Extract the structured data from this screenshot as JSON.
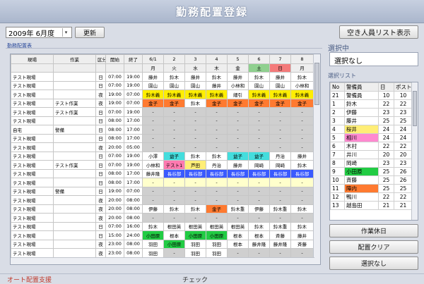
{
  "window": {
    "title": "勤務配置登録"
  },
  "date_picker": {
    "value": "2009年 6月度",
    "dropdown_glyph": "▾"
  },
  "update_button": "更新",
  "vacancy_button": "空き人員リスト表示",
  "assignments_label": "勤務配置表",
  "grid": {
    "headers": [
      "現場",
      "作業",
      "区分",
      "開始",
      "終了",
      "6/1",
      "2",
      "3",
      "4",
      "5",
      "6",
      "7",
      "8"
    ],
    "weekdays": [
      "月",
      "火",
      "水",
      "木",
      "金",
      "土",
      "日",
      "月"
    ],
    "rows": [
      {
        "site": "テスト現場",
        "work": "",
        "kubun": "日",
        "start": "07:00",
        "end": "19:00",
        "cells": [
          "藤井",
          "鈴木",
          "藤井",
          "鈴木",
          "藤井",
          "鈴木",
          "藤井",
          "鈴木"
        ],
        "colors": [
          "#ffffff",
          "#ffffff",
          "#ffffff",
          "#ffffff",
          "#ffffff",
          "#ffffff",
          "#ffffff",
          "#ffffff"
        ]
      },
      {
        "site": "テスト現場",
        "work": "",
        "kubun": "日",
        "start": "07:00",
        "end": "19:00",
        "cells": [
          "園山",
          "園山",
          "園山",
          "藤井",
          "小林和",
          "園山",
          "園山",
          "小林和"
        ],
        "colors": [
          "#ffffff",
          "#ffffff",
          "#ffffff",
          "#ffffff",
          "#ffffff",
          "#ffffff",
          "#ffffff",
          "#ffffff"
        ]
      },
      {
        "site": "テスト現場",
        "work": "",
        "kubun": "夜",
        "start": "19:00",
        "end": "07:00",
        "cells": [
          "鈴木義",
          "鈴木義",
          "鈴木義",
          "鈴木義",
          "細引",
          "鈴木義",
          "鈴木義",
          "鈴木義"
        ],
        "colors": [
          "#ffee00",
          "#ffee00",
          "#ffee00",
          "#ffee00",
          "#ffffff",
          "#ffee00",
          "#ffee00",
          "#ffee00"
        ]
      },
      {
        "site": "テスト現場",
        "work": "テスト作業",
        "kubun": "夜",
        "start": "19:00",
        "end": "07:00",
        "cells": [
          "金子",
          "金子",
          "鈴木",
          "金子",
          "金子",
          "金子",
          "金子",
          "金子"
        ],
        "colors": [
          "#ff7a30",
          "#ff7a30",
          "#ffffff",
          "#ff7a30",
          "#ff7a30",
          "#ff7a30",
          "#ff7a30",
          "#ff7a30"
        ]
      },
      {
        "site": "テスト現場",
        "work": "テスト作業",
        "kubun": "日",
        "start": "07:00",
        "end": "19:00",
        "cells": [
          "-",
          "-",
          "-",
          "-",
          "-",
          "-",
          "-",
          "-"
        ],
        "colors": [
          "#cfcfcf",
          "#cfcfcf",
          "#cfcfcf",
          "#cfcfcf",
          "#cfcfcf",
          "#cfcfcf",
          "#cfcfcf",
          "#cfcfcf"
        ]
      },
      {
        "site": "テスト現場",
        "work": "",
        "kubun": "日",
        "start": "08:00",
        "end": "17:00",
        "cells": [
          "-",
          "-",
          "-",
          "-",
          "-",
          "-",
          "-",
          "-"
        ],
        "colors": [
          "#cfcfcf",
          "#cfcfcf",
          "#cfcfcf",
          "#cfcfcf",
          "#cfcfcf",
          "#cfcfcf",
          "#cfcfcf",
          "#cfcfcf"
        ]
      },
      {
        "site": "自宅",
        "work": "警備",
        "kubun": "日",
        "start": "08:00",
        "end": "17:00",
        "cells": [
          "-",
          "-",
          "-",
          "-",
          "-",
          "-",
          "-",
          "-"
        ],
        "colors": [
          "#cfcfcf",
          "#cfcfcf",
          "#cfcfcf",
          "#cfcfcf",
          "#cfcfcf",
          "#cfcfcf",
          "#cfcfcf",
          "#cfcfcf"
        ]
      },
      {
        "site": "テスト現場",
        "work": "",
        "kubun": "日",
        "start": "08:00",
        "end": "17:00",
        "cells": [
          "-",
          "-",
          "-",
          "-",
          "-",
          "-",
          "-",
          "-"
        ],
        "colors": [
          "#cfcfcf",
          "#cfcfcf",
          "#cfcfcf",
          "#cfcfcf",
          "#cfcfcf",
          "#cfcfcf",
          "#cfcfcf",
          "#cfcfcf"
        ]
      },
      {
        "site": "テスト現場",
        "work": "",
        "kubun": "夜",
        "start": "20:00",
        "end": "05:00",
        "cells": [
          "-",
          "-",
          "-",
          "-",
          "-",
          "-",
          "-",
          "-"
        ],
        "colors": [
          "#cfcfcf",
          "#cfcfcf",
          "#cfcfcf",
          "#cfcfcf",
          "#cfcfcf",
          "#cfcfcf",
          "#cfcfcf",
          "#cfcfcf"
        ]
      },
      {
        "site": "テスト現場",
        "work": "",
        "kubun": "日",
        "start": "07:00",
        "end": "19:00",
        "cells": [
          "小澤",
          "益子",
          "鈴木",
          "鈴木",
          "益子",
          "益子",
          "丹治",
          "藤井"
        ],
        "colors": [
          "#ffffff",
          "#44dddd",
          "#ffffff",
          "#ffffff",
          "#44dddd",
          "#44dddd",
          "#ffffff",
          "#ffffff"
        ]
      },
      {
        "site": "テスト現場",
        "work": "テスト作業",
        "kubun": "日",
        "start": "07:00",
        "end": "19:00",
        "cells": [
          "小林和",
          "テスト1",
          "芦田",
          "丹治",
          "藤井",
          "岡崎",
          "岡崎",
          "鈴木"
        ],
        "colors": [
          "#ffffff",
          "#ff7ab0",
          "#ffee77",
          "#ffffff",
          "#ffffff",
          "#ffffff",
          "#ffffff",
          "#ffffff"
        ]
      },
      {
        "site": "テスト現場",
        "work": "",
        "kubun": "日",
        "start": "08:00",
        "end": "17:00",
        "cells": [
          "藤井隆",
          "長谷部",
          "長谷部",
          "長谷部",
          "長谷部",
          "長谷部",
          "長谷部",
          "長谷部"
        ],
        "colors": [
          "#ffffff",
          "#3a5aff",
          "#3a5aff",
          "#3a5aff",
          "#3a5aff",
          "#3a5aff",
          "#3a5aff",
          "#3a5aff"
        ]
      },
      {
        "site": "テスト現場",
        "work": "",
        "kubun": "日",
        "start": "08:00",
        "end": "17:00",
        "cells": [
          "-",
          "-",
          "-",
          "-",
          "-",
          "-",
          "-",
          "-"
        ],
        "colors": [
          "#ffffcc",
          "#ffffcc",
          "#ffffcc",
          "#ffffcc",
          "#ffffcc",
          "#ffffcc",
          "#ffffcc",
          "#ffffcc"
        ]
      },
      {
        "site": "テスト現場",
        "work": "警備",
        "kubun": "日",
        "start": "19:00",
        "end": "07:00",
        "cells": [
          "-",
          "-",
          "-",
          "-",
          "-",
          "-",
          "-",
          "-"
        ],
        "colors": [
          "#cfcfcf",
          "#cfcfcf",
          "#cfcfcf",
          "#cfcfcf",
          "#cfcfcf",
          "#cfcfcf",
          "#cfcfcf",
          "#cfcfcf"
        ]
      },
      {
        "site": "テスト現場",
        "work": "",
        "kubun": "夜",
        "start": "20:00",
        "end": "08:00",
        "cells": [
          "-",
          "-",
          "-",
          "-",
          "-",
          "-",
          "-",
          "-"
        ],
        "colors": [
          "#cfcfcf",
          "#cfcfcf",
          "#cfcfcf",
          "#cfcfcf",
          "#cfcfcf",
          "#cfcfcf",
          "#cfcfcf",
          "#cfcfcf"
        ]
      },
      {
        "site": "テスト現場",
        "work": "",
        "kubun": "夜",
        "start": "20:00",
        "end": "08:00",
        "cells": [
          "伊藤",
          "鈴木",
          "鈴木",
          "金子",
          "鈴木重",
          "伊藤",
          "鈴木重",
          "鈴木"
        ],
        "colors": [
          "#ffffff",
          "#ffffff",
          "#ffffff",
          "#ff7a30",
          "#ffffff",
          "#ffffff",
          "#ffffff",
          "#ffffff"
        ]
      },
      {
        "site": "テスト現場",
        "work": "",
        "kubun": "夜",
        "start": "20:00",
        "end": "08:00",
        "cells": [
          "-",
          "-",
          "-",
          "-",
          "-",
          "-",
          "-",
          "-"
        ],
        "colors": [
          "#cfcfcf",
          "#cfcfcf",
          "#cfcfcf",
          "#cfcfcf",
          "#cfcfcf",
          "#cfcfcf",
          "#cfcfcf",
          "#cfcfcf"
        ]
      },
      {
        "site": "テスト現場",
        "work": "",
        "kubun": "日",
        "start": "07:00",
        "end": "16:00",
        "cells": [
          "鈴木",
          "根田英",
          "根田英",
          "根田英",
          "根田英",
          "鈴木",
          "鈴木重",
          "鈴木"
        ],
        "colors": [
          "#ffffff",
          "#ffffff",
          "#ffffff",
          "#ffffff",
          "#ffffff",
          "#ffffff",
          "#ffffff",
          "#ffffff"
        ]
      },
      {
        "site": "テスト現場",
        "work": "",
        "kubun": "日",
        "start": "15:00",
        "end": "24:00",
        "cells": [
          "小田原",
          "根本",
          "小田原",
          "小田原",
          "根本",
          "根本",
          "斉藤",
          "藤井"
        ],
        "colors": [
          "#22cc44",
          "#ffffff",
          "#22cc44",
          "#22cc44",
          "#ffffff",
          "#ffffff",
          "#ffffff",
          "#ffffff"
        ]
      },
      {
        "site": "テスト現場",
        "work": "",
        "kubun": "夜",
        "start": "23:00",
        "end": "08:00",
        "cells": [
          "羽田",
          "小田原",
          "羽田",
          "羽田",
          "根本",
          "藤井隆",
          "藤井隆",
          "斉藤"
        ],
        "colors": [
          "#ffffff",
          "#22cc44",
          "#ffffff",
          "#ffffff",
          "#ffffff",
          "#ffffff",
          "#ffffff",
          "#ffffff"
        ]
      },
      {
        "site": "テスト現場",
        "work": "",
        "kubun": "夜",
        "start": "23:00",
        "end": "08:00",
        "cells": [
          "羽田",
          "-",
          "羽田",
          "羽田",
          "-",
          "-",
          "-",
          "-"
        ],
        "colors": [
          "#ffffff",
          "#cfcfcf",
          "#ffffff",
          "#ffffff",
          "#cfcfcf",
          "#cfcfcf",
          "#cfcfcf",
          "#cfcfcf"
        ]
      }
    ]
  },
  "selection": {
    "label": "選択中",
    "value": "選択なし"
  },
  "select_list": {
    "label": "選択リスト",
    "headers": [
      "No",
      "警備員",
      "日",
      "ポスト"
    ],
    "rows": [
      {
        "no": "21",
        "name": "警備員",
        "d": "10",
        "p": "10",
        "color": "#ffffff"
      },
      {
        "no": "1",
        "name": "鈴木",
        "d": "22",
        "p": "22",
        "color": "#ffffff"
      },
      {
        "no": "2",
        "name": "伊藤",
        "d": "23",
        "p": "23",
        "color": "#ffffff"
      },
      {
        "no": "3",
        "name": "藤井",
        "d": "25",
        "p": "25",
        "color": "#ffffff"
      },
      {
        "no": "4",
        "name": "桜井",
        "d": "24",
        "p": "24",
        "color": "#ffee77"
      },
      {
        "no": "5",
        "name": "相川",
        "d": "24",
        "p": "24",
        "color": "#ff8ad0"
      },
      {
        "no": "6",
        "name": "木村",
        "d": "22",
        "p": "22",
        "color": "#ffffff"
      },
      {
        "no": "7",
        "name": "井川",
        "d": "20",
        "p": "20",
        "color": "#ffffff"
      },
      {
        "no": "8",
        "name": "岡崎",
        "d": "23",
        "p": "23",
        "color": "#ffffff"
      },
      {
        "no": "9",
        "name": "小田原",
        "d": "25",
        "p": "26",
        "color": "#22cc44"
      },
      {
        "no": "10",
        "name": "斉藤",
        "d": "25",
        "p": "26",
        "color": "#ffffff"
      },
      {
        "no": "11",
        "name": "陣内",
        "d": "25",
        "p": "25",
        "color": "#ff7a30"
      },
      {
        "no": "12",
        "name": "鴨川",
        "d": "22",
        "p": "22",
        "color": "#ffffff"
      },
      {
        "no": "13",
        "name": "越島田",
        "d": "21",
        "p": "21",
        "color": "#ffffff"
      }
    ]
  },
  "buttons": {
    "work_off": "作業休日",
    "clear": "配置クリア",
    "deselect": "選択なし"
  },
  "bottom": {
    "auto_assign": "オート配置支援",
    "check": "チェック"
  }
}
